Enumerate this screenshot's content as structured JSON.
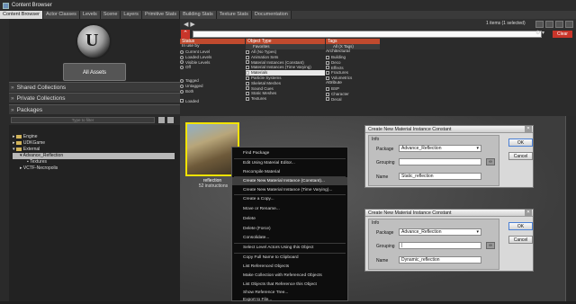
{
  "window": {
    "title": "Content Browser"
  },
  "tabs": [
    "Content Browser",
    "Actor Classes",
    "Levels",
    "Scene",
    "Layers",
    "Primitive Stats",
    "Building Stats",
    "Texture Stats",
    "Documentation"
  ],
  "toolbar": {
    "items_count": "1 items (1 selected)",
    "nav_arrows": "◀ ▶",
    "tools": "⚙ ▾"
  },
  "search": {
    "value": "",
    "clear_label": "Clear"
  },
  "left": {
    "all_assets_label": "All Assets",
    "sections": [
      {
        "label": "Shared Collections"
      },
      {
        "label": "Private Collections"
      },
      {
        "label": "Packages"
      }
    ],
    "type_filter_placeholder": "Type to filter",
    "tree": [
      {
        "label": "Engine",
        "indent": 1
      },
      {
        "label": "UDKGame",
        "indent": 1
      },
      {
        "label": "External",
        "indent": 1
      },
      {
        "label": "Advance_Reflection",
        "indent": 2,
        "selected": true
      },
      {
        "label": "Textures",
        "indent": 3
      },
      {
        "label": "VCTF-Necropolis",
        "indent": 2
      }
    ]
  },
  "filters": {
    "status": {
      "header": "Status",
      "groups": [
        {
          "title": "In use by",
          "items": [
            "Current Level",
            "Loaded Levels",
            "Visible Levels",
            "Off"
          ],
          "type": "radio"
        },
        {
          "title": "",
          "items": [
            "Tagged",
            "Untagged",
            "Both"
          ],
          "type": "radio"
        },
        {
          "title": "",
          "items": [
            "Loaded"
          ],
          "type": "check"
        }
      ]
    },
    "object_type": {
      "header": "Object Type",
      "sub": "Favorites",
      "items": [
        "All (No Types)",
        "Animation Sets",
        "Material Instances (Constant)",
        "Material Instances (Time Varying)",
        "Materials",
        "Particle Systems",
        "Skeletal Meshes",
        "Sound Cues",
        "Static Meshes",
        "Textures"
      ],
      "highlighted": "Materials"
    },
    "tags": {
      "header": "Tags",
      "sub": "All (X Tags)",
      "groups": [
        {
          "title": "Architectural",
          "items": [
            "Building",
            "Deco",
            "Effects",
            "Fractures",
            "Volumetrics"
          ]
        },
        {
          "title": "Attribute",
          "items": [
            "BSP",
            "Character",
            "Decal"
          ]
        }
      ]
    }
  },
  "asset": {
    "name": "reflection",
    "info": "52 instructions"
  },
  "context_menu": {
    "items": [
      "Find Package",
      "Edit Using Material Editor...",
      "Recompile Material",
      "Create New Material Instance (Constant)...",
      "Create New Material Instance (Time Varying)...",
      "Create a Copy...",
      "Move or Rename...",
      "Delete",
      "Delete (Force)",
      "Consolidate...",
      "Select Level Actors Using this Object",
      "Copy Full Name to Clipboard",
      "List Referenced Objects",
      "Make Collection with Referenced Objects",
      "List Objects that Reference this Object",
      "Show Reference Tree...",
      "Export to File..."
    ],
    "highlighted": "Create New Material Instance (Constant)..."
  },
  "dialogs": [
    {
      "title": "Create New Material Instance Constant",
      "info": "Info",
      "package_label": "Package",
      "package_value": "Advance_Reflection",
      "grouping_label": "Grouping",
      "grouping_value": "",
      "name_label": "Name",
      "name_value": "Static_reflection",
      "ok": "OK",
      "cancel": "Cancel"
    },
    {
      "title": "Create New Material Instance Constant",
      "info": "Info",
      "package_label": "Package",
      "package_value": "Advance_Reflection",
      "grouping_label": "Grouping",
      "grouping_value": "|",
      "name_label": "Name",
      "name_value": "Dynamic_reflection",
      "ok": "OK",
      "cancel": "Cancel"
    }
  ]
}
